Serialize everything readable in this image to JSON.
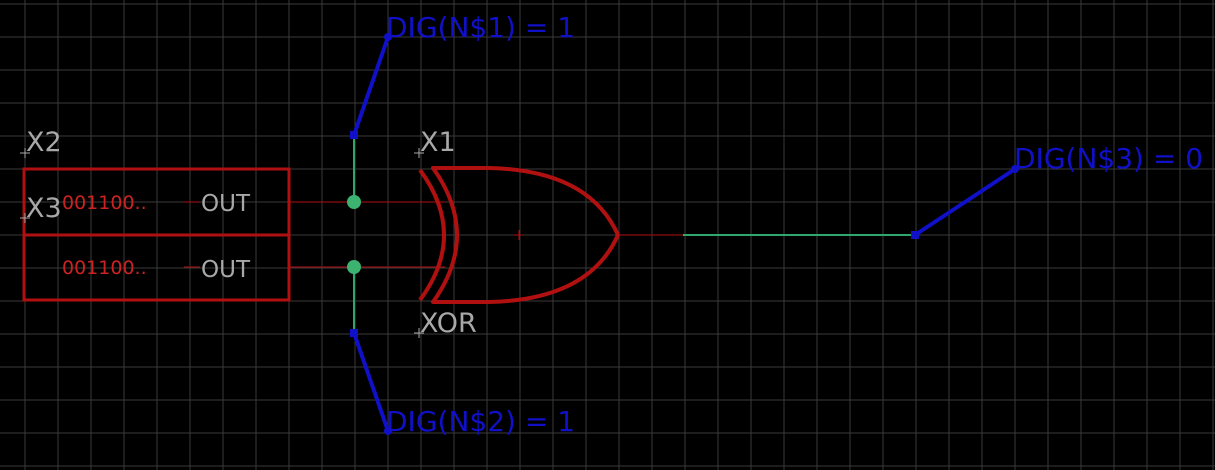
{
  "colors": {
    "background": "#000000",
    "grid": "#3a3a3a",
    "symbol": "#b01010",
    "symbol_text": "#cc2222",
    "net": "#2fa66a",
    "junction": "#3cb371",
    "probe": "#1010c8",
    "name_text": "#a8a8a8"
  },
  "parts": {
    "x2_name": "X2",
    "x3_name": "X3",
    "x2_value": "001100..",
    "x3_value": "001100..",
    "x2_pin": "OUT",
    "x3_pin": "OUT",
    "gate_name": "X1",
    "gate_type": "XOR"
  },
  "probes": {
    "n1": "DIG(N$1) = 1",
    "n2": "DIG(N$2) = 1",
    "n3": "DIG(N$3) = 0"
  }
}
